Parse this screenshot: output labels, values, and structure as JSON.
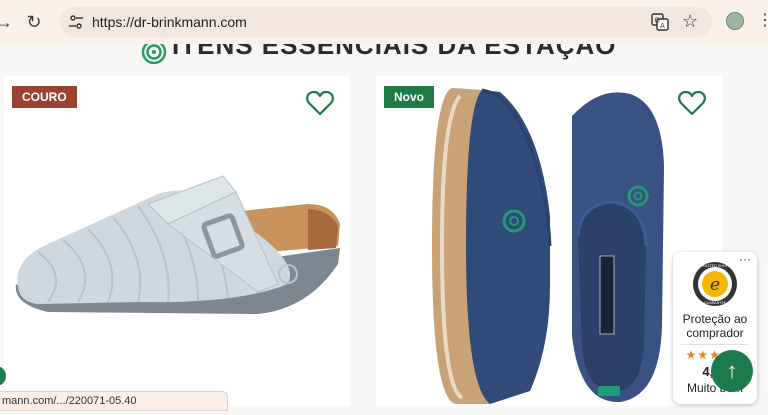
{
  "browser": {
    "url": "https://dr-brinkmann.com",
    "status_url": "mann.com/.../220071-05.40"
  },
  "page": {
    "section_title": "ITENS ESSENCIAIS DA ESTAÇÃO"
  },
  "products": [
    {
      "badge": "COURO",
      "badge_color": "#9a4330"
    },
    {
      "badge": "Novo",
      "badge_color": "#1f7a45"
    }
  ],
  "trust": {
    "line1": "Proteção ao",
    "line2": "comprador",
    "stars": "★★★★★",
    "score": "4,73",
    "label": "Muito bom",
    "dots": "···",
    "seal_top": "TRUSTED SHOPS",
    "seal_bottom": "GUARANTEE",
    "seal_letter": "e"
  },
  "colors": {
    "brand_green": "#1c7a4c",
    "star_orange": "#e0841f"
  }
}
